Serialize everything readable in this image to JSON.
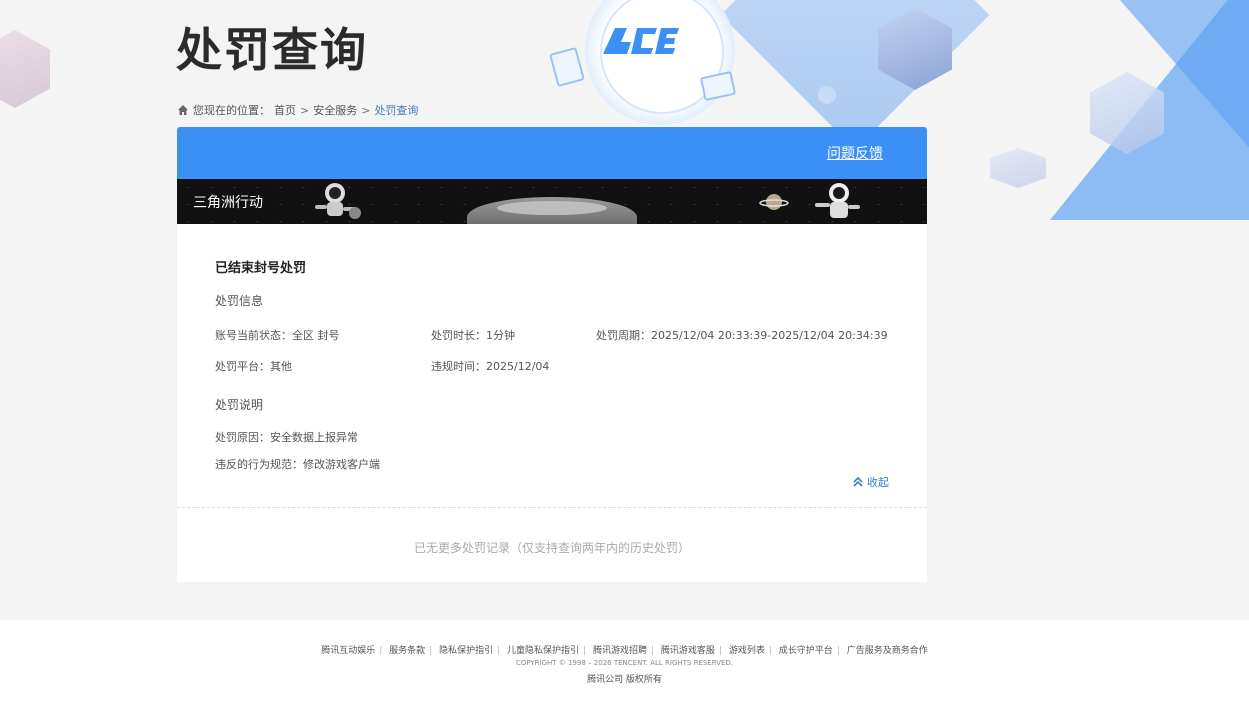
{
  "page": {
    "title": "处罚查询"
  },
  "breadcrumb": {
    "prefix": "您现在的位置：",
    "items": [
      "首页",
      "安全服务",
      "处罚查询"
    ]
  },
  "panel": {
    "feedback_label": "问题反馈",
    "game_name": "三角洲行动",
    "record": {
      "title": "已结束封号处罚",
      "info_section_title": "处罚信息",
      "account_status": "账号当前状态：全区 封号",
      "duration": "处罚时长：1分钟",
      "period": "处罚周期：2025/12/04 20:33:39-2025/12/04 20:34:39",
      "platform": "处罚平台：其他",
      "violation_time": "违规时间：2025/12/04",
      "desc_section_title": "处罚说明",
      "reason": "处罚原因：安全数据上报异常",
      "rule": "违反的行为规范：修改游戏客户端",
      "collapse_label": "收起"
    },
    "no_more_text": "已无更多处罚记录（仅支持查询两年内的历史处罚）"
  },
  "footer": {
    "links": [
      "腾讯互动娱乐",
      "服务条款",
      "隐私保护指引",
      "儿童隐私保护指引",
      "腾讯游戏招聘",
      "腾讯游戏客服",
      "游戏列表",
      "成长守护平台",
      "广告服务及商务合作"
    ],
    "copyright": "COPYRIGHT © 1998 – 2026 TENCENT. ALL RIGHTS RESERVED.",
    "owner": "腾讯公司 版权所有"
  },
  "colors": {
    "accent": "#3c8ff5",
    "link": "#3a7cc9"
  },
  "icons": {
    "breadcrumb": "home-icon",
    "collapse": "double-chevron-up-icon"
  }
}
